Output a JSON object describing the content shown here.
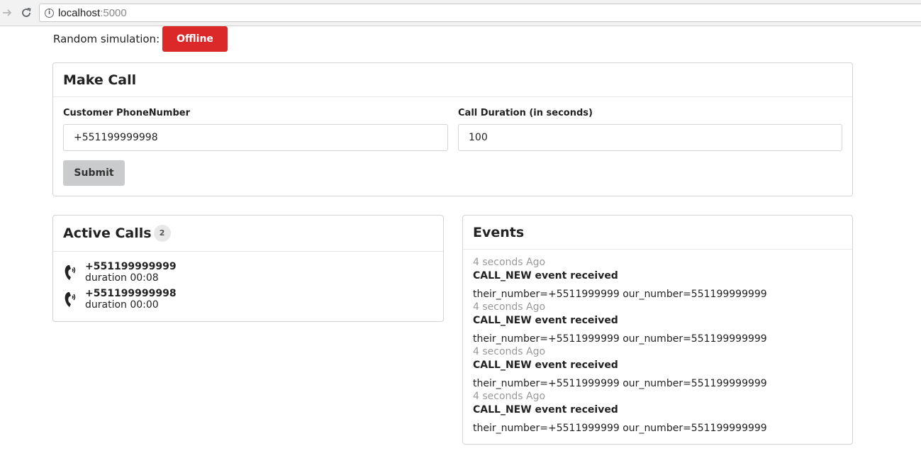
{
  "browser": {
    "url_host": "localhost",
    "url_port": ":5000"
  },
  "simulation": {
    "label": "Random simulation:",
    "status_button": "Offline",
    "status_color": "#db2828"
  },
  "make_call": {
    "title": "Make Call",
    "phone_label": "Customer PhoneNumber",
    "phone_value": "+551199999998",
    "duration_label": "Call Duration (in seconds)",
    "duration_value": "100",
    "submit_label": "Submit"
  },
  "active_calls": {
    "title": "Active Calls",
    "count": "2",
    "calls": [
      {
        "number": "+551199999999",
        "duration": "duration 00:08",
        "icon": "phone-icon"
      },
      {
        "number": "+551199999998",
        "duration": "duration 00:00",
        "icon": "phone-icon"
      }
    ]
  },
  "events": {
    "title": "Events",
    "items": [
      {
        "time": "4 seconds Ago",
        "title": "CALL_NEW event received",
        "detail": "their_number=+5511999999 our_number=551199999999"
      },
      {
        "time": "4 seconds Ago",
        "title": "CALL_NEW event received",
        "detail": "their_number=+5511999999 our_number=551199999999"
      },
      {
        "time": "4 seconds Ago",
        "title": "CALL_NEW event received",
        "detail": "their_number=+5511999999 our_number=551199999999"
      },
      {
        "time": "4 seconds Ago",
        "title": "CALL_NEW event received",
        "detail": "their_number=+5511999999 our_number=551199999999"
      }
    ]
  }
}
